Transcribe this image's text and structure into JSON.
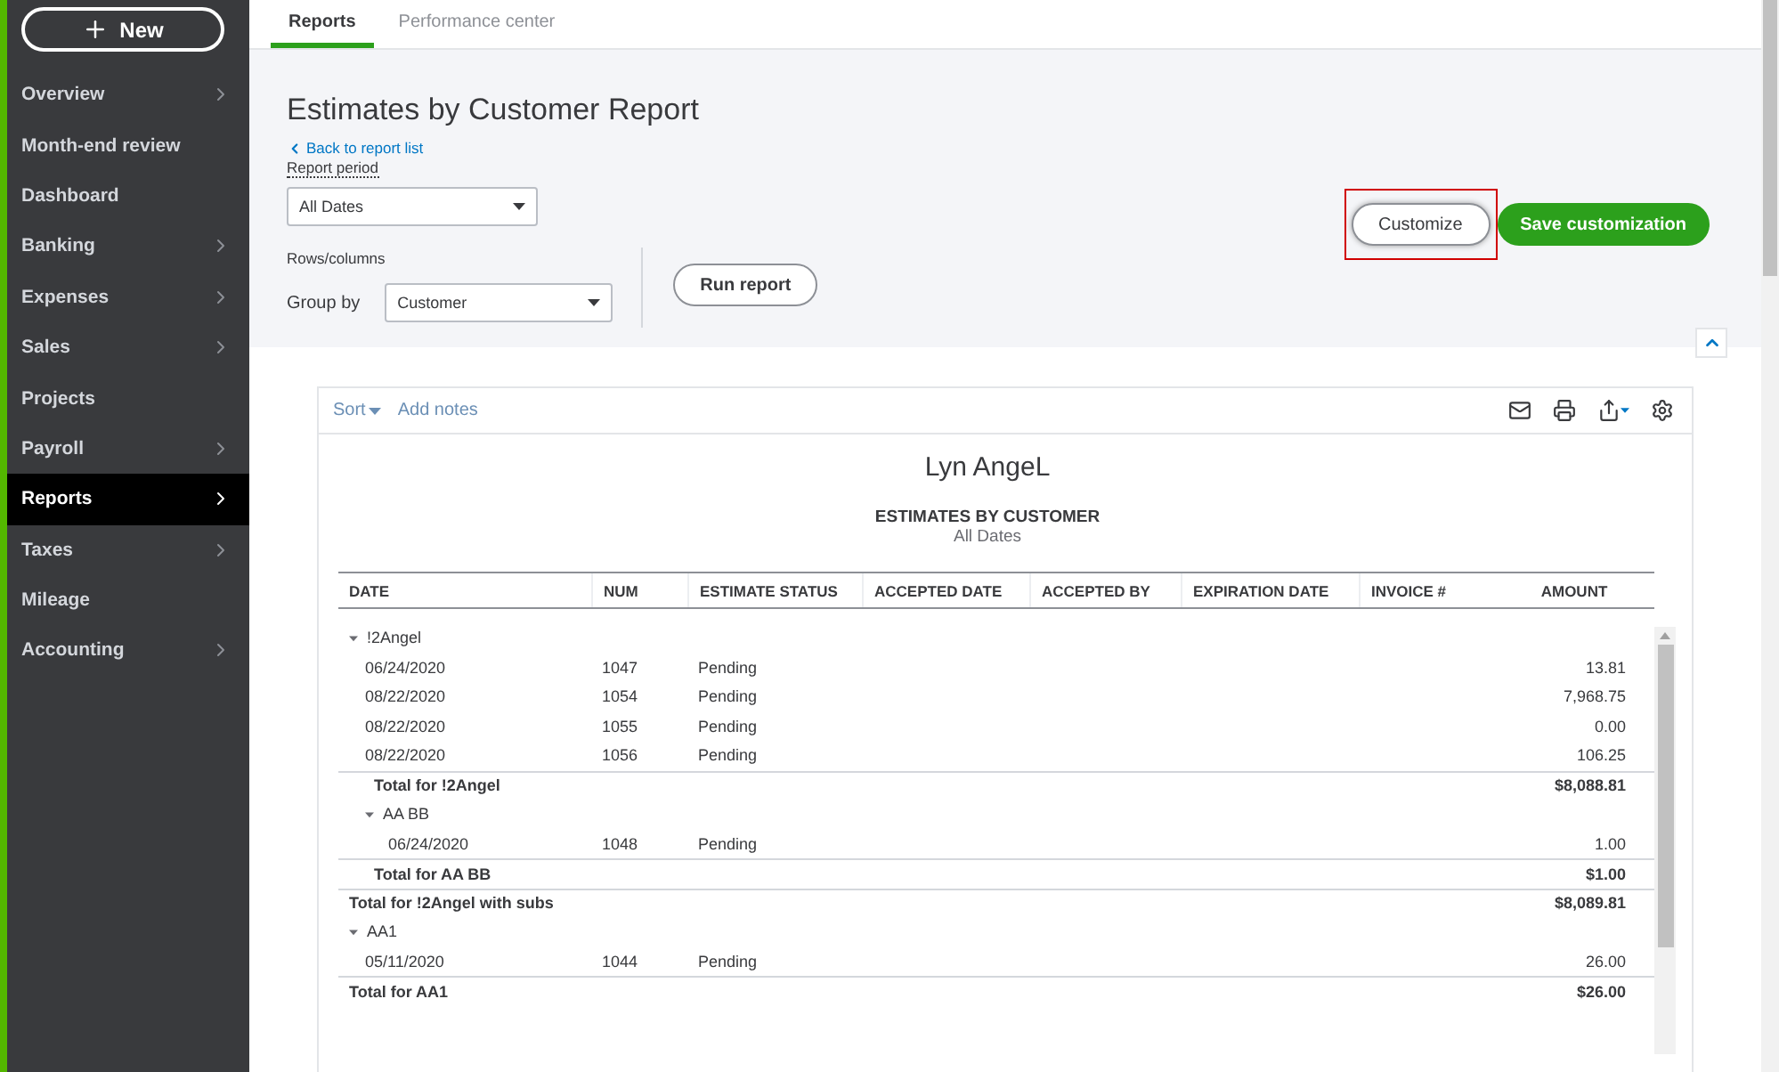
{
  "new_button": "New",
  "sidebar": {
    "items": [
      {
        "label": "Overview",
        "submenu": true,
        "selected": false
      },
      {
        "label": "Month-end review",
        "submenu": false,
        "selected": false
      },
      {
        "label": "Dashboard",
        "submenu": false,
        "selected": false
      },
      {
        "label": "Banking",
        "submenu": true,
        "selected": false
      },
      {
        "label": "Expenses",
        "submenu": true,
        "selected": false
      },
      {
        "label": "Sales",
        "submenu": true,
        "selected": false
      },
      {
        "label": "Projects",
        "submenu": false,
        "selected": false
      },
      {
        "label": "Payroll",
        "submenu": true,
        "selected": false
      },
      {
        "label": "Reports",
        "submenu": true,
        "selected": true
      },
      {
        "label": "Taxes",
        "submenu": true,
        "selected": false
      },
      {
        "label": "Mileage",
        "submenu": false,
        "selected": false
      },
      {
        "label": "Accounting",
        "submenu": true,
        "selected": false
      }
    ]
  },
  "tabs": [
    {
      "label": "Reports",
      "selected": true
    },
    {
      "label": "Performance center",
      "selected": false
    }
  ],
  "header": {
    "title": "Estimates by Customer Report",
    "back_link": "Back to report list",
    "report_period_label": "Report period",
    "report_period": "All Dates",
    "rows_columns_label": "Rows/columns",
    "group_by_label": "Group by",
    "group_by": "Customer",
    "run_report": "Run report",
    "customize": "Customize",
    "save_customization": "Save customization"
  },
  "toolbar": {
    "sort": "Sort",
    "add_notes": "Add notes"
  },
  "report": {
    "company": "Lyn AngeL",
    "title": "ESTIMATES BY CUSTOMER",
    "period": "All Dates",
    "columns": [
      "DATE",
      "NUM",
      "ESTIMATE STATUS",
      "ACCEPTED DATE",
      "ACCEPTED BY",
      "EXPIRATION DATE",
      "INVOICE #",
      "AMOUNT"
    ],
    "groups": [
      {
        "name": "!2Angel",
        "expanded": true,
        "rows": [
          {
            "date": "06/24/2020",
            "num": "1047",
            "status": "Pending",
            "amount": "13.81"
          },
          {
            "date": "08/22/2020",
            "num": "1054",
            "status": "Pending",
            "amount": "7,968.75"
          },
          {
            "date": "08/22/2020",
            "num": "1055",
            "status": "Pending",
            "amount": "0.00"
          },
          {
            "date": "08/22/2020",
            "num": "1056",
            "status": "Pending",
            "amount": "106.25"
          }
        ],
        "subtotal": {
          "label": "Total for !2Angel",
          "amount": "$8,088.81"
        },
        "children": [
          {
            "name": "AA BB",
            "expanded": true,
            "rows": [
              {
                "date": "06/24/2020",
                "num": "1048",
                "status": "Pending",
                "amount": "1.00"
              }
            ],
            "subtotal": {
              "label": "Total for AA BB",
              "amount": "$1.00"
            }
          }
        ],
        "total": {
          "label": "Total for !2Angel with subs",
          "amount": "$8,089.81"
        }
      },
      {
        "name": "AA1",
        "expanded": true,
        "rows": [
          {
            "date": "05/11/2020",
            "num": "1044",
            "status": "Pending",
            "amount": "26.00"
          }
        ],
        "total": {
          "label": "Total for AA1",
          "amount": "$26.00"
        }
      }
    ]
  }
}
